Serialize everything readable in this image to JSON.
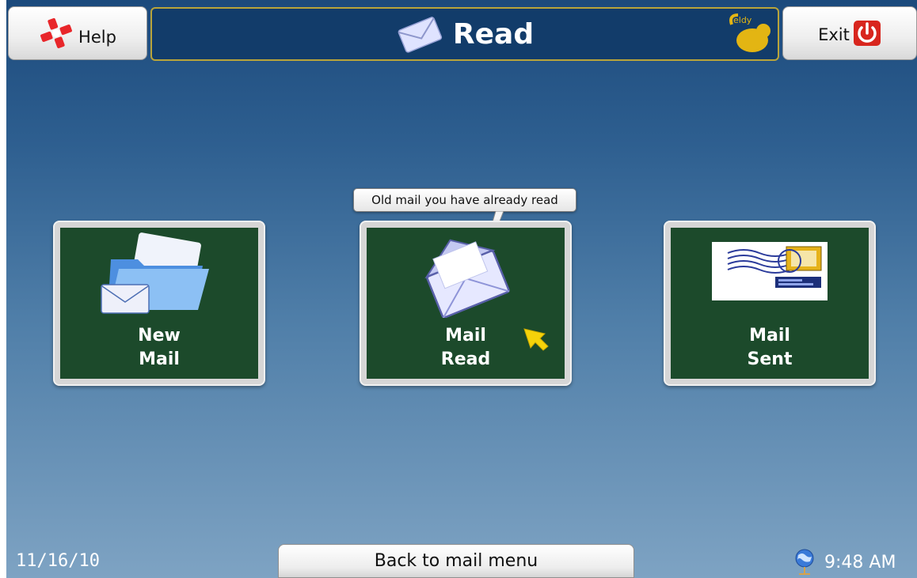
{
  "header": {
    "help_label": "Help",
    "title": "Read",
    "exit_label": "Exit",
    "logo_text": "eldy"
  },
  "tooltip": {
    "text": "Old mail you have already read"
  },
  "cards": [
    {
      "line1": "New",
      "line2": "Mail",
      "icon": "folder-mail-icon"
    },
    {
      "line1": "Mail",
      "line2": "Read",
      "icon": "open-envelope-icon"
    },
    {
      "line1": "Mail",
      "line2": "Sent",
      "icon": "postmarked-envelope-icon"
    }
  ],
  "footer": {
    "date": "11/16/10",
    "back_label": "Back to mail menu",
    "time": "9:48 AM"
  },
  "colors": {
    "title_bar": "#123c6a",
    "title_border": "#b9a43a",
    "card_bg": "#1c4a2b",
    "exit_red": "#d8261e",
    "pointer_yellow": "#f5d20a"
  }
}
